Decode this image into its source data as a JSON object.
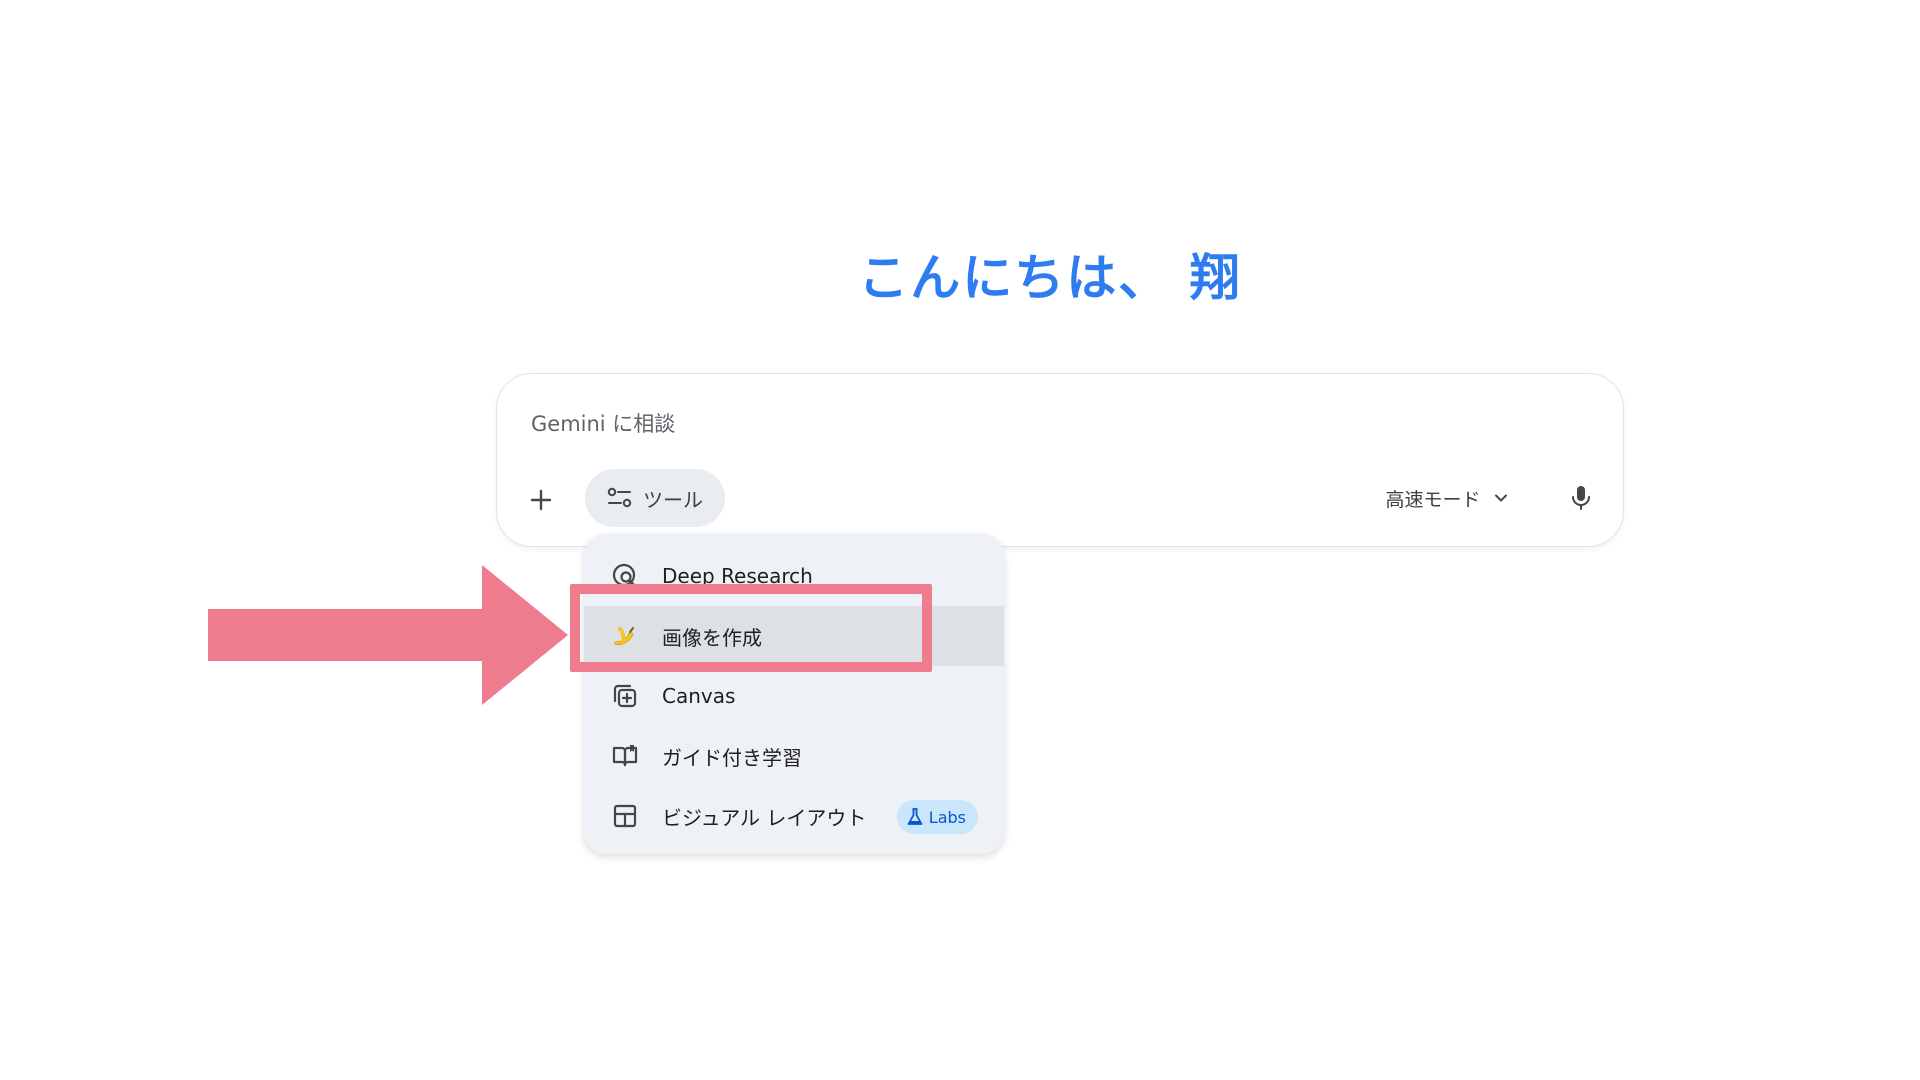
{
  "greeting": "こんにちは、 翔",
  "composer": {
    "placeholder": "Gemini に相談",
    "tools_label": "ツール",
    "mode_label": "高速モード"
  },
  "tools_menu": {
    "items": [
      {
        "label": "Deep Research",
        "icon": "deep-research-icon"
      },
      {
        "label": "画像を作成",
        "icon": "banana-icon"
      },
      {
        "label": "Canvas",
        "icon": "canvas-icon"
      },
      {
        "label": "ガイド付き学習",
        "icon": "book-icon"
      },
      {
        "label": "ビジュアル レイアウト",
        "icon": "layout-icon",
        "badge": "Labs"
      }
    ],
    "selected_index": 1
  },
  "colors": {
    "greeting": "#2f7cf0",
    "annotation": "#ee7c8e",
    "menu_bg": "#eef1f6",
    "labs_bg": "#c9e6fb"
  }
}
